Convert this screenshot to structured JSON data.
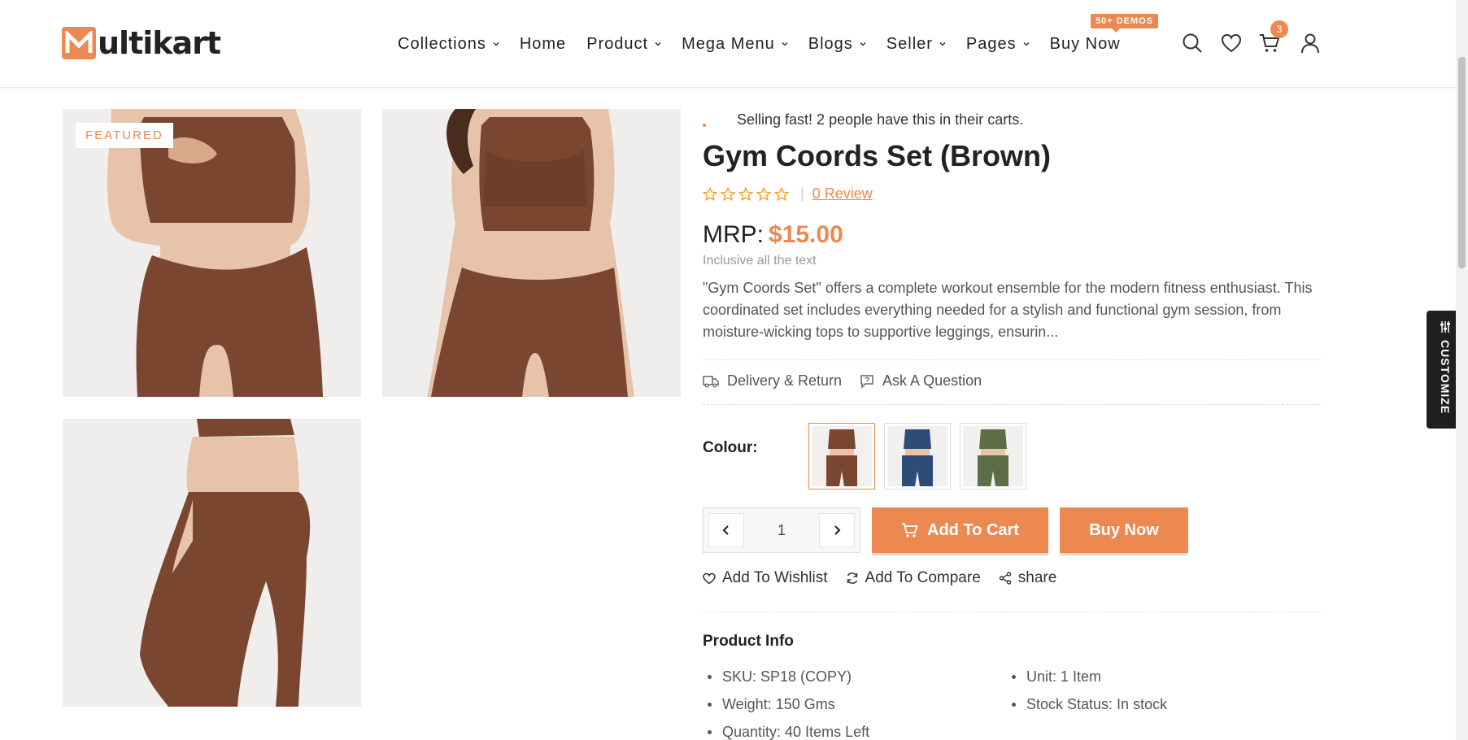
{
  "brand": {
    "logo_text": "ultikart",
    "accent": "#ec8951"
  },
  "nav": {
    "items": [
      {
        "label": "Collections",
        "dropdown": true
      },
      {
        "label": "Home",
        "dropdown": false
      },
      {
        "label": "Product",
        "dropdown": true
      },
      {
        "label": "Mega Menu",
        "dropdown": true
      },
      {
        "label": "Blogs",
        "dropdown": true
      },
      {
        "label": "Seller",
        "dropdown": true
      },
      {
        "label": "Pages",
        "dropdown": true
      },
      {
        "label": "Buy Now",
        "dropdown": false
      }
    ],
    "demo_badge": "50+ DEMOS",
    "cart_count": "3",
    "icons": [
      "search-icon",
      "heart-icon",
      "cart-icon",
      "user-icon"
    ]
  },
  "gallery": {
    "featured_label": "FEATURED"
  },
  "product": {
    "selling_fast": "Selling fast! 2 people have this in their carts.",
    "title": "Gym Coords Set (Brown)",
    "rating": 0,
    "review_link": "0 Review",
    "price_label": "MRP:",
    "price": "$15.00",
    "tax_note": "Inclusive all the text",
    "description": "\"Gym Coords Set\" offers a complete workout ensemble for the modern fitness enthusiast. This coordinated set includes everything needed for a stylish and functional gym session, from moisture-wicking tops to supportive leggings, ensurin...",
    "delivery_link": "Delivery & Return",
    "question_link": "Ask A Question",
    "colour_label": "Colour:",
    "colours": [
      {
        "name": "brown",
        "hex": "#7a4630",
        "selected": true
      },
      {
        "name": "blue",
        "hex": "#2f4b78",
        "selected": false
      },
      {
        "name": "green",
        "hex": "#5b6e45",
        "selected": false
      }
    ],
    "quantity": "1",
    "add_to_cart": "Add To Cart",
    "buy_now": "Buy Now",
    "wishlist": "Add To Wishlist",
    "compare": "Add To Compare",
    "share": "share"
  },
  "product_info": {
    "title": "Product Info",
    "left": [
      "SKU: SP18 (COPY)",
      "Weight: 150 Gms",
      "Quantity: 40 Items Left"
    ],
    "right": [
      "Unit: 1 Item",
      "Stock Status: In stock"
    ]
  },
  "customize_label": "CUSTOMIZE"
}
